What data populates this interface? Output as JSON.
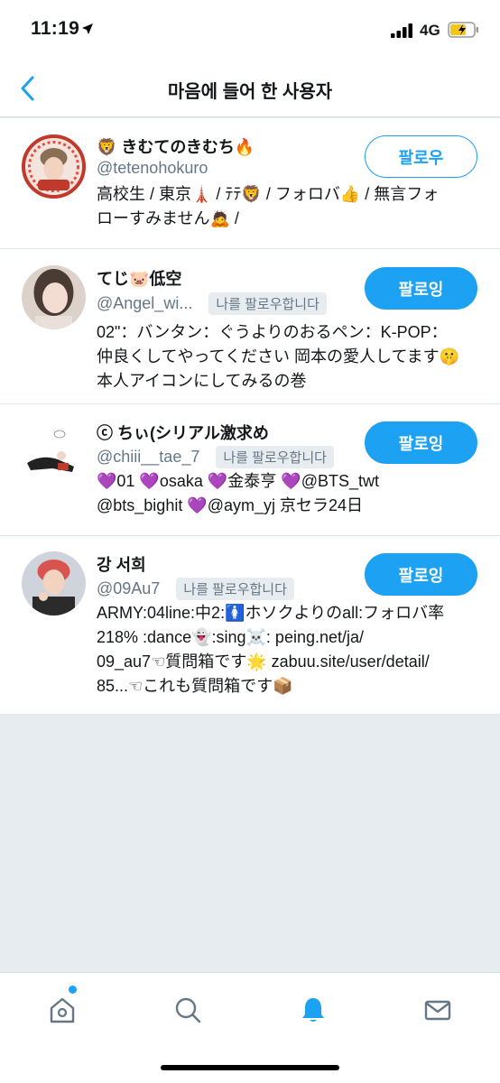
{
  "status_bar": {
    "time": "11:19",
    "network": "4G"
  },
  "header": {
    "title": "마음에 들어 한 사용자"
  },
  "users": [
    {
      "name": "🦁 きむてのきむち🔥",
      "handle": "@tetenohokuro",
      "follows_you": "",
      "bio_lines": [
        "高校生 / 東京🗼 / ﾃﾃ🦁 / フォロバ👍 / 無言フォ",
        "ローすみません🙇 /"
      ],
      "button": "팔로우",
      "following": false
    },
    {
      "name": "てじ🐷低空",
      "handle": "@Angel_wi...",
      "follows_you": "나를 팔로우합니다",
      "bio_lines": [
        "02\"：バンタン：ぐうよりのおるペン：K-POP：",
        "仲良くしてやってください 岡本の愛人してます🤫",
        "本人アイコンにしてみるの巻"
      ],
      "button": "팔로잉",
      "following": true
    },
    {
      "name": "ⓒ ちぃ(シリアル激求め",
      "handle": "@chiii__tae_7",
      "follows_you": "나를 팔로우합니다",
      "bio_lines": [
        "💜01 💜osaka 💜金泰亨 💜@BTS_twt",
        "@bts_bighit 💜@aym_yj 京セラ24日"
      ],
      "button": "팔로잉",
      "following": true
    },
    {
      "name": "강 서희",
      "handle": "@09Au7",
      "follows_you": "나를 팔로우합니다",
      "bio_lines": [
        "ARMY:04line:中2:🚺ホソクよりのall:フォロバ率",
        "218% :dance👻:sing☠️: peing.net/ja/",
        "09_au7☜質問箱です🌟 zabuu.site/user/detail/",
        "85...☜これも質問箱です📦"
      ],
      "button": "팔로잉",
      "following": true
    }
  ],
  "tab_bar": {
    "tabs": [
      "home-icon",
      "search-icon",
      "notifications-icon",
      "messages-icon"
    ],
    "active": "notifications-icon"
  },
  "colors": {
    "accent": "#1da1f2",
    "text": "#14171a",
    "secondary": "#657786",
    "background": "#e6ecf0"
  }
}
